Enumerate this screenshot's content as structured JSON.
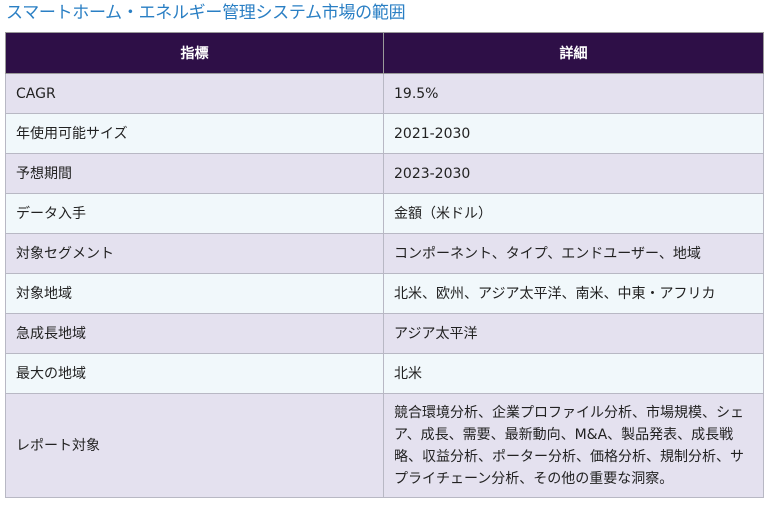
{
  "page": {
    "title": "スマートホーム・エネルギー管理システム市場の範囲"
  },
  "table": {
    "headers": {
      "metric": "指標",
      "detail": "詳細"
    },
    "rows": [
      {
        "metric": "CAGR",
        "detail": "19.5%"
      },
      {
        "metric": "年使用可能サイズ",
        "detail": "2021-2030"
      },
      {
        "metric": "予想期間",
        "detail": "2023-2030"
      },
      {
        "metric": "データ入手",
        "detail": "金額（米ドル）"
      },
      {
        "metric": "対象セグメント",
        "detail": "コンポーネント、タイプ、エンドユーザー、地域"
      },
      {
        "metric": "対象地域",
        "detail": "北米、欧州、アジア太平洋、南米、中東・アフリカ"
      },
      {
        "metric": "急成長地域",
        "detail": "アジア太平洋"
      },
      {
        "metric": "最大の地域",
        "detail": "北米"
      },
      {
        "metric": "レポート対象",
        "detail": "競合環境分析、企業プロファイル分析、市場規模、シェア、成長、需要、最新動向、M&A、製品発表、成長戦略、収益分析、ポーター分析、価格分析、規制分析、サプライチェーン分析、その他の重要な洞察。"
      }
    ]
  },
  "colors": {
    "title": "#2a7fc4",
    "header_bg": "#2e0f47",
    "row_odd": "#e4e1ef",
    "row_even": "#f1f8fb"
  }
}
